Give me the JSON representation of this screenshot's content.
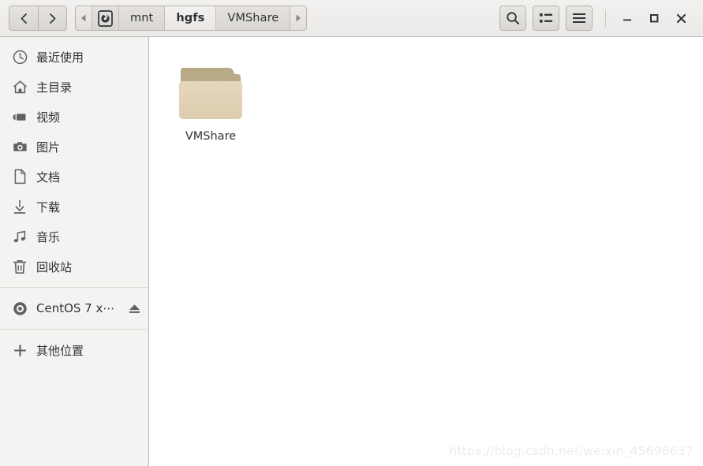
{
  "header": {
    "nav": {
      "back_label": "‹",
      "forward_label": "›",
      "back_name": "back",
      "forward_name": "forward"
    },
    "pathbar": {
      "scroll_left": "◀",
      "scroll_right": "▶",
      "root_icon": "drive-icon",
      "crumbs": [
        {
          "label": "mnt",
          "current": false
        },
        {
          "label": "hgfs",
          "current": true
        },
        {
          "label": "VMShare",
          "current": false
        }
      ]
    },
    "tools": [
      {
        "name": "search-button",
        "icon": "search-icon"
      },
      {
        "name": "view-options-button",
        "icon": "list-view-icon"
      },
      {
        "name": "main-menu-button",
        "icon": "hamburger-menu-icon"
      }
    ],
    "window_controls": [
      {
        "name": "minimize-button",
        "icon": "minimize-icon"
      },
      {
        "name": "maximize-button",
        "icon": "maximize-icon"
      },
      {
        "name": "close-button",
        "icon": "close-icon"
      }
    ]
  },
  "sidebar": {
    "items": [
      {
        "label": "最近使用",
        "icon": "clock-icon",
        "name": "sidebar-item-recent"
      },
      {
        "label": "主目录",
        "icon": "home-icon",
        "name": "sidebar-item-home"
      },
      {
        "label": "视频",
        "icon": "video-icon",
        "name": "sidebar-item-videos"
      },
      {
        "label": "图片",
        "icon": "camera-icon",
        "name": "sidebar-item-pictures"
      },
      {
        "label": "文档",
        "icon": "document-icon",
        "name": "sidebar-item-documents"
      },
      {
        "label": "下载",
        "icon": "download-icon",
        "name": "sidebar-item-downloads"
      },
      {
        "label": "音乐",
        "icon": "music-icon",
        "name": "sidebar-item-music"
      },
      {
        "label": "回收站",
        "icon": "trash-icon",
        "name": "sidebar-item-trash"
      }
    ],
    "devices": [
      {
        "label": "CentOS 7 x⋯",
        "icon": "disc-icon",
        "eject_icon": "eject-icon",
        "name": "sidebar-item-centos-disc"
      }
    ],
    "other": {
      "label": "其他位置",
      "icon": "plus-icon",
      "name": "sidebar-item-other-locations"
    }
  },
  "content": {
    "files": [
      {
        "label": "VMShare",
        "type": "folder"
      }
    ],
    "watermark": "https://blog.csdn.net/weixin_45698637"
  },
  "colors": {
    "sidebar_bg": "#f4f3f1",
    "header_bg": "#f0efee",
    "content_bg": "#ffffff",
    "folder_front": "#e3d3b8",
    "folder_back": "#b8a987",
    "text": "#2e3436"
  }
}
